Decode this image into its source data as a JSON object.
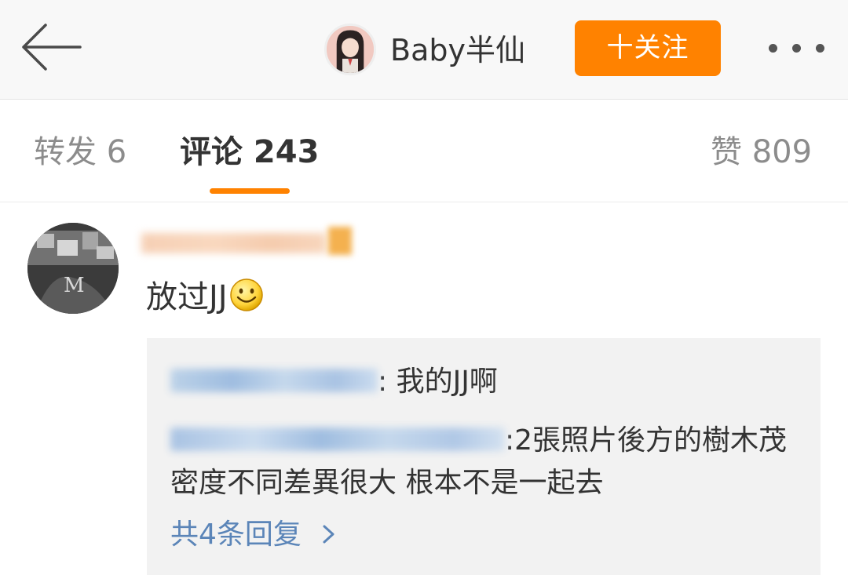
{
  "navbar": {
    "icons": {
      "back": "arrow-left-icon",
      "more": "more-dots-icon"
    },
    "title": "Baby半仙",
    "follow_label": "十关注",
    "colors": {
      "follow_bg": "#ff8200",
      "background": "#f8f8f8"
    }
  },
  "tabs": {
    "repost": "转发 6",
    "comment": "评论 243",
    "like": "赞 809",
    "active": "comment",
    "accent": "#ff8200"
  },
  "comment": {
    "text": "放过JJ",
    "emoji": "smile-emoji-icon",
    "replies": [
      {
        "text": ": 我的JJ啊"
      },
      {
        "text": ":2張照片後方的樹木茂密度不同差異很大 根本不是一起去"
      }
    ],
    "more_replies": "共4条回复",
    "link_color": "#5b85b8"
  }
}
